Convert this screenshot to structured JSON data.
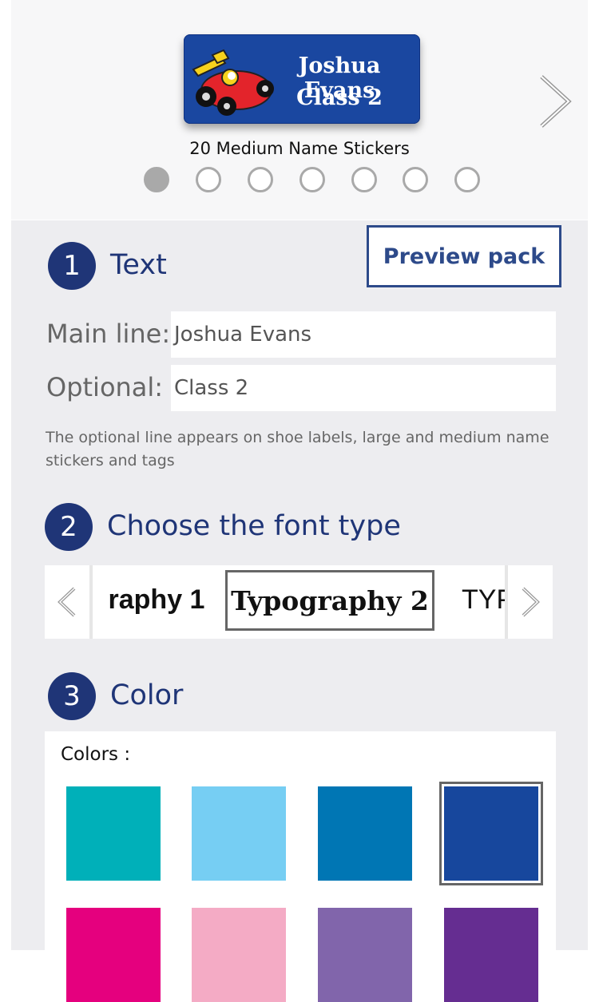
{
  "preview": {
    "sticker_line1": "Joshua Evans",
    "sticker_line2": "Class 2",
    "caption": "20 Medium Name Stickers",
    "slide_count": 7,
    "active_slide": 1
  },
  "section_text": {
    "number": "1",
    "title": "Text",
    "preview_button": "Preview pack",
    "main_line_label": "Main line:",
    "main_line_value": "Joshua Evans",
    "optional_label": "Optional:",
    "optional_value": "Class 2",
    "note": "The optional line appears on shoe labels, large and medium name stickers and tags"
  },
  "section_font": {
    "number": "2",
    "title": "Choose the font type",
    "options": [
      "raphy 1",
      "Typography 2",
      "TYP"
    ],
    "selected": "Typography 2"
  },
  "section_color": {
    "number": "3",
    "title": "Color",
    "colors_label": "Colors :",
    "swatches": [
      {
        "color": "#00b0b9",
        "selected": false
      },
      {
        "color": "#76cef3",
        "selected": false
      },
      {
        "color": "#0076b4",
        "selected": false
      },
      {
        "color": "#17479d",
        "selected": true
      },
      {
        "color": "#e5007e",
        "selected": false
      },
      {
        "color": "#f4abc5",
        "selected": false
      },
      {
        "color": "#8165ab",
        "selected": false
      },
      {
        "color": "#652d91",
        "selected": false
      }
    ]
  },
  "colors": {
    "accent_navy": "#1f3577",
    "sticker_blue": "#1a47a0",
    "panel_bg": "#ededf0"
  }
}
